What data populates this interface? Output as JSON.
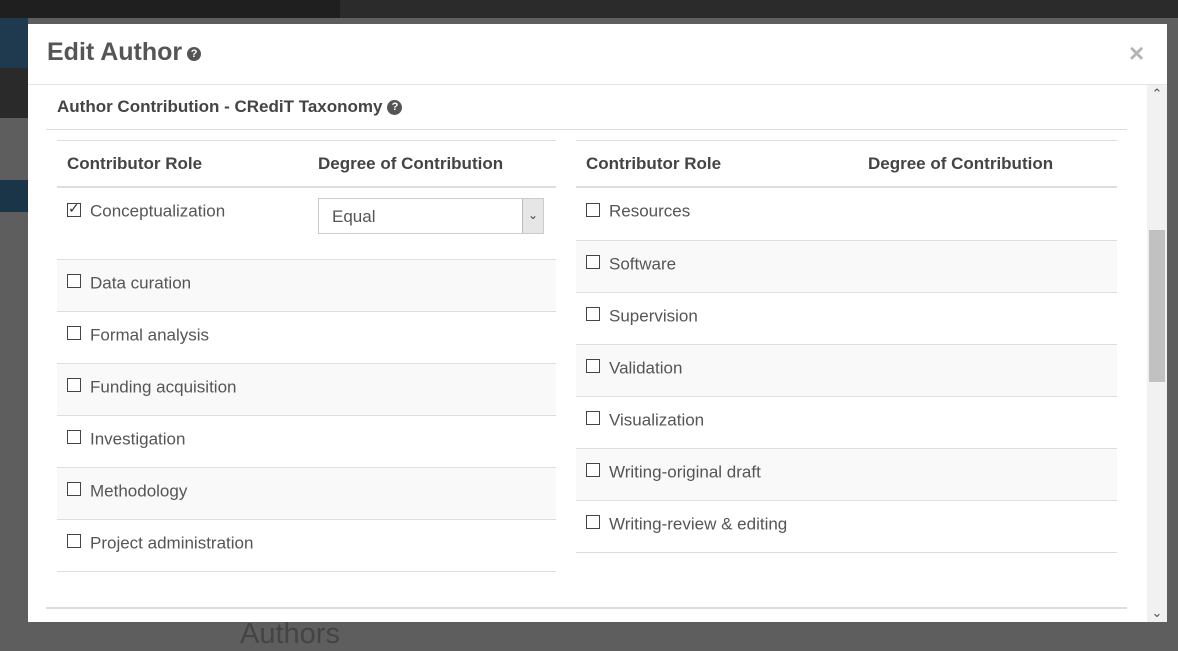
{
  "modal": {
    "title": "Edit Author",
    "title_help": "?",
    "close": "×"
  },
  "section": {
    "title": "Author Contribution - CRediT Taxonomy",
    "help": "?"
  },
  "table_left": {
    "headers": [
      "Contributor Role",
      "Degree of Contribution"
    ],
    "rows": [
      {
        "label": "Conceptualization",
        "checked": true,
        "degree": "Equal"
      },
      {
        "label": "Data curation",
        "checked": false
      },
      {
        "label": "Formal analysis",
        "checked": false
      },
      {
        "label": "Funding acquisition",
        "checked": false
      },
      {
        "label": "Investigation",
        "checked": false
      },
      {
        "label": "Methodology",
        "checked": false
      },
      {
        "label": "Project administration",
        "checked": false
      }
    ]
  },
  "table_right": {
    "headers": [
      "Contributor Role",
      "Degree of Contribution"
    ],
    "rows": [
      {
        "label": "Resources",
        "checked": false
      },
      {
        "label": "Software",
        "checked": false
      },
      {
        "label": "Supervision",
        "checked": false
      },
      {
        "label": "Validation",
        "checked": false
      },
      {
        "label": "Visualization",
        "checked": false
      },
      {
        "label": "Writing-original draft",
        "checked": false
      },
      {
        "label": "Writing-review & editing",
        "checked": false
      }
    ]
  },
  "background": {
    "footer_heading": "Authors"
  },
  "colors": {
    "overlay": "#5e5e5e",
    "modal_bg": "#ffffff",
    "stripe": "#f9f9f9",
    "text": "#555555"
  },
  "icons": {
    "help": "question-circle-icon",
    "close": "close-icon",
    "select_arrow": "chevron-down-icon",
    "scroll_up": "chevron-up-icon",
    "scroll_down": "chevron-down-icon"
  }
}
